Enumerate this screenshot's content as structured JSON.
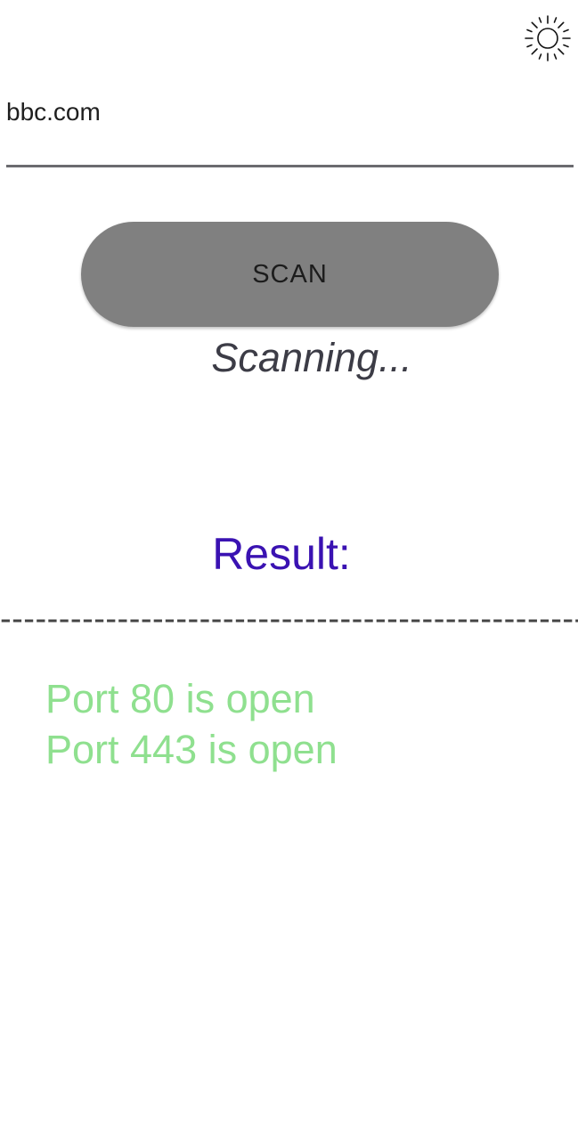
{
  "toolbar": {
    "theme_icon": "sun-icon"
  },
  "scan_form": {
    "host_value": "bbc.com",
    "scan_label": "SCAN"
  },
  "status": {
    "text": "Scanning..."
  },
  "result": {
    "heading": "Result:",
    "divider": "---------------------------------------------------",
    "ports": [
      "Port 80 is open",
      "Port 443 is open"
    ]
  },
  "colors": {
    "button_bg": "#808080",
    "heading": "#3a12b2",
    "port_text": "#8fe08f",
    "status_text": "#3c3c46"
  }
}
